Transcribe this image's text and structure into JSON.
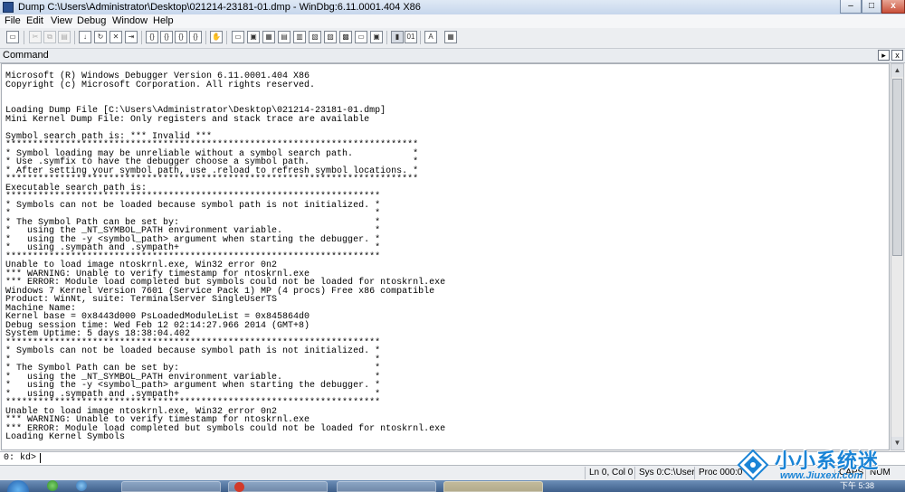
{
  "window": {
    "title": "Dump C:\\Users\\Administrator\\Desktop\\021214-23181-01.dmp - WinDbg:6.11.0001.404 X86",
    "minimize_glyph": "–",
    "maximize_glyph": "□",
    "close_glyph": "x"
  },
  "menu": [
    "File",
    "Edit",
    "View",
    "Debug",
    "Window",
    "Help"
  ],
  "toolbar": {
    "icons": [
      "open-icon",
      "cut-icon",
      "copy-icon",
      "paste-icon",
      "go-icon",
      "restart-icon",
      "stop-debugging-icon",
      "detach-icon",
      "break-icon",
      "step-into-icon",
      "step-over-icon",
      "step-out-icon",
      "run-to-cursor-icon",
      "breakpoint-icon",
      "command-window-icon",
      "watch-icon",
      "locals-icon",
      "registers-icon",
      "memory-icon",
      "call-stack-icon",
      "disassembly-icon",
      "scratch-pad-icon",
      "source-mode-icon",
      "font-icon",
      "options-icon"
    ]
  },
  "command_window": {
    "title": "Command",
    "output_lines": [
      "Microsoft (R) Windows Debugger Version 6.11.0001.404 X86",
      "Copyright (c) Microsoft Corporation. All rights reserved.",
      "",
      "",
      "Loading Dump File [C:\\Users\\Administrator\\Desktop\\021214-23181-01.dmp]",
      "Mini Kernel Dump File: Only registers and stack trace are available",
      "",
      "Symbol search path is: *** Invalid ***",
      "****************************************************************************",
      "* Symbol loading may be unreliable without a symbol search path.           *",
      "* Use .symfix to have the debugger choose a symbol path.                   *",
      "* After setting your symbol path, use .reload to refresh symbol locations. *",
      "****************************************************************************",
      "Executable search path is:",
      "*********************************************************************",
      "* Symbols can not be loaded because symbol path is not initialized. *",
      "*                                                                   *",
      "* The Symbol Path can be set by:                                    *",
      "*   using the _NT_SYMBOL_PATH environment variable.                 *",
      "*   using the -y <symbol_path> argument when starting the debugger. *",
      "*   using .sympath and .sympath+                                    *",
      "*********************************************************************",
      "Unable to load image ntoskrnl.exe, Win32 error 0n2",
      "*** WARNING: Unable to verify timestamp for ntoskrnl.exe",
      "*** ERROR: Module load completed but symbols could not be loaded for ntoskrnl.exe",
      "Windows 7 Kernel Version 7601 (Service Pack 1) MP (4 procs) Free x86 compatible",
      "Product: WinNt, suite: TerminalServer SingleUserTS",
      "Machine Name:",
      "Kernel base = 0x8443d000 PsLoadedModuleList = 0x845864d0",
      "Debug session time: Wed Feb 12 02:14:27.966 2014 (GMT+8)",
      "System Uptime: 5 days 18:38:04.402",
      "*********************************************************************",
      "* Symbols can not be loaded because symbol path is not initialized. *",
      "*                                                                   *",
      "* The Symbol Path can be set by:                                    *",
      "*   using the _NT_SYMBOL_PATH environment variable.                 *",
      "*   using the -y <symbol_path> argument when starting the debugger. *",
      "*   using .sympath and .sympath+                                    *",
      "*********************************************************************",
      "Unable to load image ntoskrnl.exe, Win32 error 0n2",
      "*** WARNING: Unable to verify timestamp for ntoskrnl.exe",
      "*** ERROR: Module load completed but symbols could not be loaded for ntoskrnl.exe",
      "Loading Kernel Symbols"
    ],
    "prompt": "0: kd>",
    "input_value": ""
  },
  "statusbar": {
    "position": "Ln 0, Col 0",
    "sys": "Sys 0:C:\\User",
    "proc": "Proc 000:0",
    "num": "NUM",
    "caps": "CAPS"
  },
  "taskbar": {
    "time": "下午 5:38"
  },
  "watermark": {
    "title": "小小系统迷",
    "url": "www.Jiuxexi.com"
  }
}
